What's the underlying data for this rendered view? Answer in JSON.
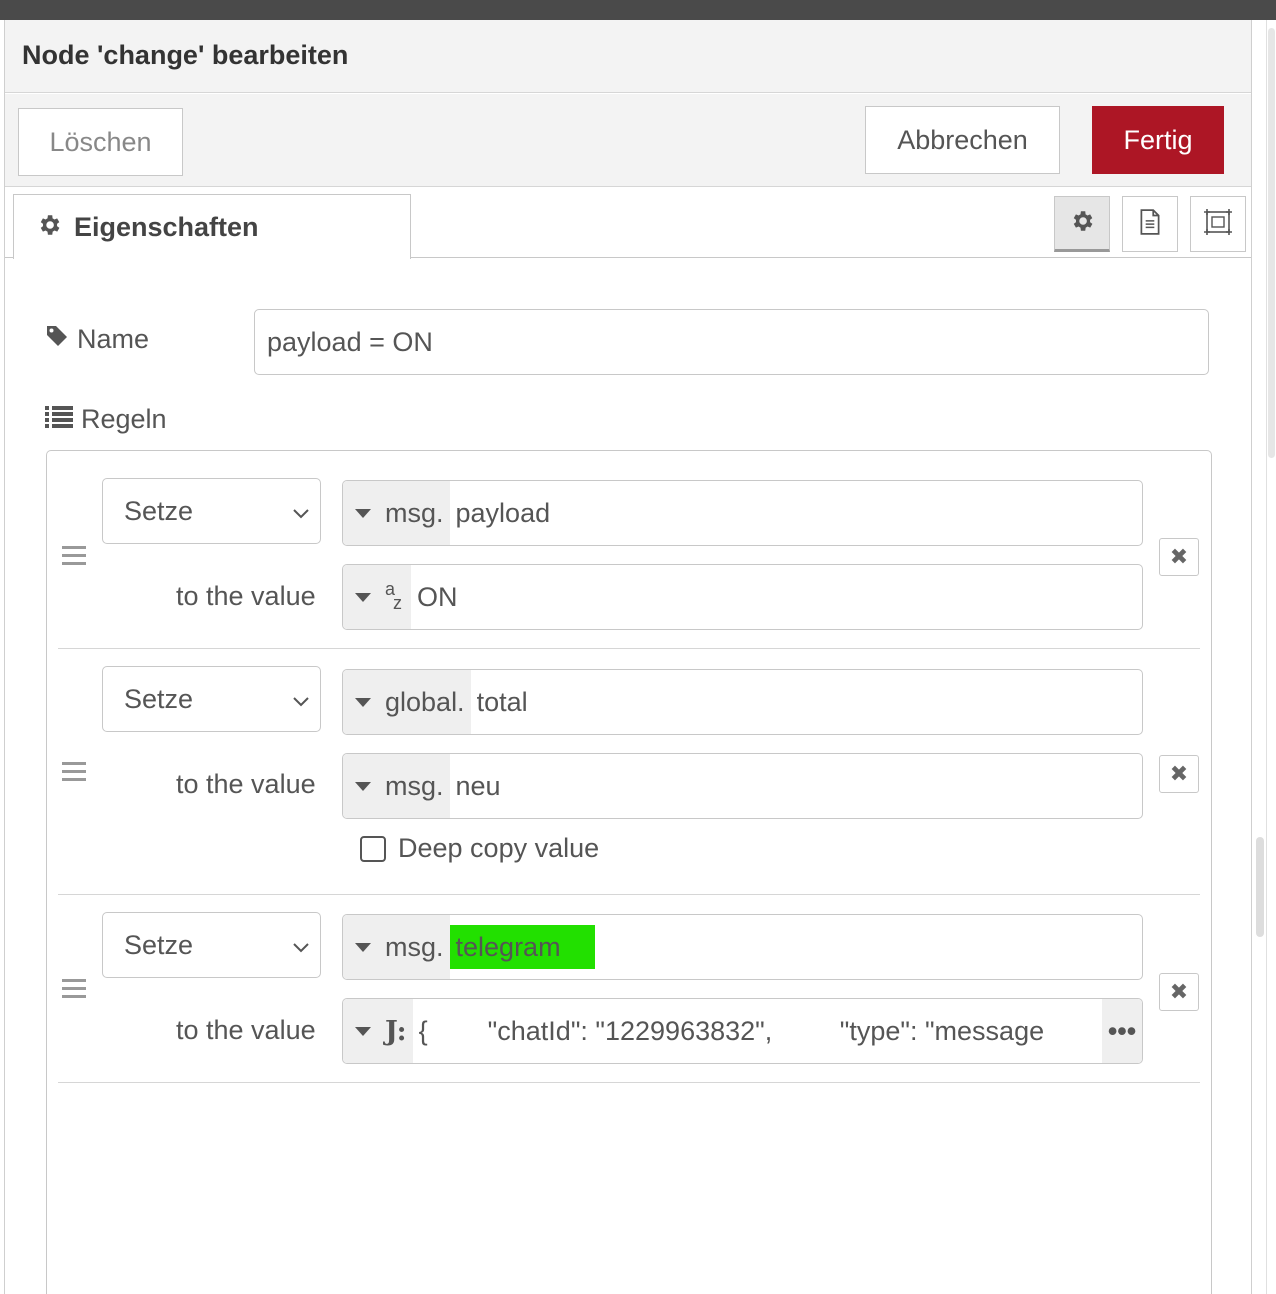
{
  "tray": {
    "title": "Node 'change' bearbeiten",
    "buttons": {
      "delete": "Löschen",
      "cancel": "Abbrechen",
      "done": "Fertig"
    },
    "done_color": "#ad1625"
  },
  "tabs": {
    "properties_label": "Eigenschaften",
    "icons": [
      "gear-icon",
      "document-icon",
      "appearance-icon"
    ]
  },
  "form": {
    "name_label": "Name",
    "name_value": "payload = ON",
    "rules_label": "Regeln"
  },
  "rules": [
    {
      "action": "Setze",
      "target_type": "msg.",
      "target_value": "payload",
      "to_label": "to the value",
      "value_type": "az",
      "value_type_sup": "a",
      "value_type_sub": "z",
      "value": "ON"
    },
    {
      "action": "Setze",
      "target_type": "global.",
      "target_value": "total",
      "to_label": "to the value",
      "value_type": "msg.",
      "value": "neu",
      "deep_copy_label": "Deep copy value",
      "deep_copy_checked": false
    },
    {
      "action": "Setze",
      "target_type": "msg.",
      "target_value": "telegram",
      "target_highlight": "#22e000",
      "to_label": "to the value",
      "value_type": "J:",
      "value": "{        \"chatId\": \"1229963832\",         \"type\": \"message",
      "expand_label": "•••"
    }
  ]
}
